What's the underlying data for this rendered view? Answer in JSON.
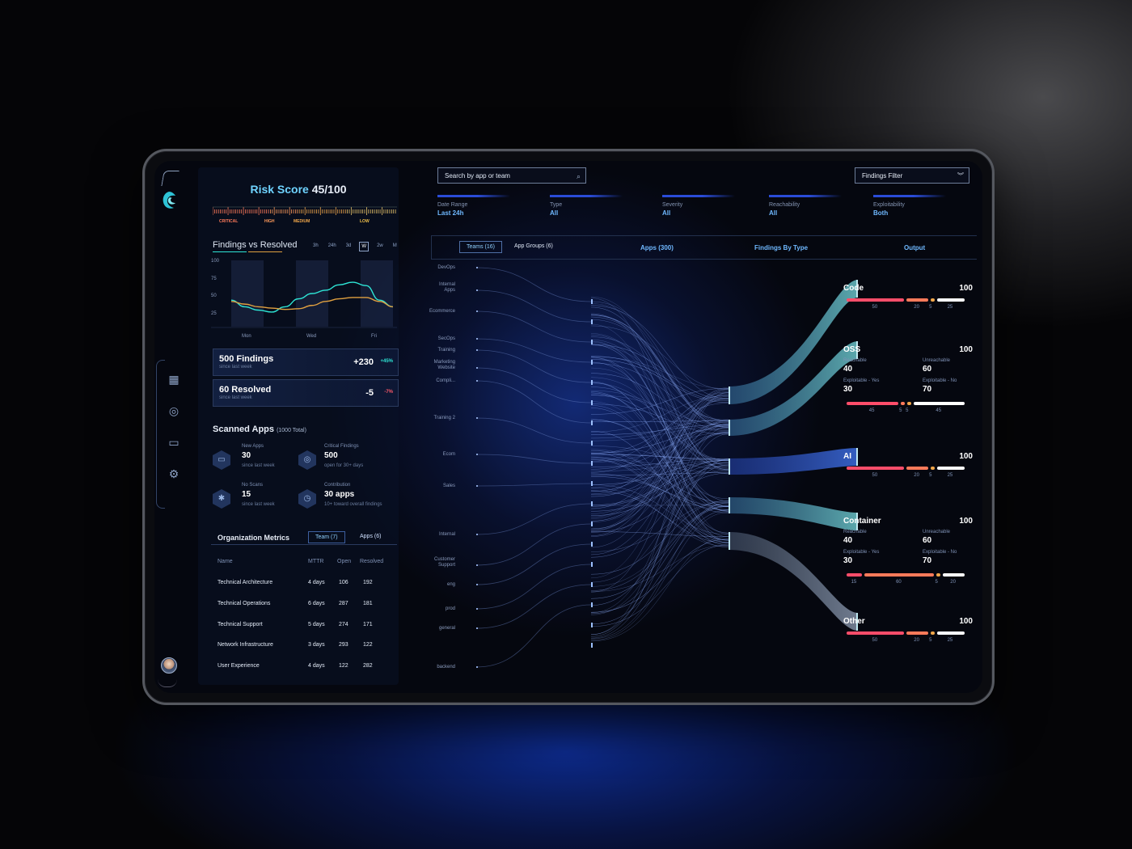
{
  "risk": {
    "label": "Risk Score",
    "value": "45/100",
    "levels": [
      "CRITICAL",
      "HIGH",
      "MEDIUM",
      "LOW"
    ]
  },
  "findings_chart": {
    "title": "Findings vs Resolved",
    "ranges": [
      "3h",
      "24h",
      "3d",
      "W",
      "2w",
      "M"
    ],
    "selected_range": "W",
    "y_ticks": [
      "100",
      "75",
      "50",
      "25"
    ],
    "x_ticks": [
      "Mon",
      "Wed",
      "Fri"
    ]
  },
  "chart_data": {
    "type": "line",
    "ylim": [
      0,
      100
    ],
    "xlabel": "",
    "ylabel": "",
    "x_tick_labels": [
      "Mon",
      "Wed",
      "Fri"
    ],
    "series": [
      {
        "color": "#2ee6d6",
        "values": [
          40,
          30,
          25,
          22,
          30,
          42,
          50,
          55,
          63,
          67,
          62,
          40,
          30
        ]
      },
      {
        "color": "#e0a040",
        "values": [
          38,
          34,
          30,
          28,
          26,
          27,
          32,
          38,
          42,
          44,
          44,
          38,
          30
        ]
      }
    ]
  },
  "stats": [
    {
      "value": "500 Findings",
      "sub": "since last week",
      "delta": "+230",
      "pct": "+45%",
      "pct_color": "#2ee6d6"
    },
    {
      "value": "60 Resolved",
      "sub": "since last week",
      "delta": "-5",
      "pct": "-7%",
      "pct_color": "#ff5a6a"
    }
  ],
  "scanned": {
    "title": "Scanned Apps",
    "total": "(1000 Total)",
    "items": [
      {
        "label": "New Apps",
        "value": "30",
        "sub": "since last week",
        "icon": "window-icon"
      },
      {
        "label": "Critical Findings",
        "value": "500",
        "sub": "open for 30+ days",
        "icon": "target-icon"
      },
      {
        "label": "No Scans",
        "value": "15",
        "sub": "since last week",
        "icon": "puzzle-icon"
      },
      {
        "label": "Contribution",
        "value": "30 apps",
        "sub": "10+ toward overall findings",
        "icon": "clock-icon"
      }
    ]
  },
  "org": {
    "title": "Organization Metrics",
    "tabs": [
      "Team (7)",
      "Apps (6)"
    ],
    "columns": [
      "Name",
      "MTTR",
      "Open",
      "Resolved"
    ],
    "rows": [
      [
        "Technical Architecture",
        "4 days",
        "106",
        "192"
      ],
      [
        "Technical Operations",
        "6 days",
        "287",
        "181"
      ],
      [
        "Technical Support",
        "5 days",
        "274",
        "171"
      ],
      [
        "Network Infrastructure",
        "3 days",
        "293",
        "122"
      ],
      [
        "User Experience",
        "4 days",
        "122",
        "282"
      ]
    ]
  },
  "search": {
    "placeholder": "Search by app or team"
  },
  "findings_filter": "Findings Filter",
  "filters": [
    {
      "label": "Date Range",
      "value": "Last 24h"
    },
    {
      "label": "Type",
      "value": "All"
    },
    {
      "label": "Severity",
      "value": "All"
    },
    {
      "label": "Reachability",
      "value": "All"
    },
    {
      "label": "Exploitability",
      "value": "Both"
    }
  ],
  "flow_tabs": {
    "teams": "Teams (16)",
    "groups": "App Groups (6)",
    "apps": "Apps (300)",
    "types": "Findings By Type",
    "output": "Output"
  },
  "sources": [
    "DevOps",
    "Internal\nApps",
    "Ecommerce",
    "SecOps",
    "Training",
    "Marketing\nWebsite",
    "Compli...",
    "Training 2",
    "Ecom",
    "Sales",
    "Internal",
    "Customer\nSupport",
    "eng",
    "prod",
    "general",
    "backend"
  ],
  "outputs": [
    {
      "name": "Code",
      "score": "100",
      "bars": [
        "50",
        "20",
        "5",
        "25"
      ]
    },
    {
      "name": "OSS",
      "score": "100",
      "reachable": "40",
      "unreachable": "60",
      "expl_yes": "30",
      "expl_no": "70",
      "bars": [
        "45",
        "5",
        "5",
        "45"
      ]
    },
    {
      "name": "AI",
      "score": "100",
      "bars": [
        "50",
        "20",
        "5",
        "25"
      ]
    },
    {
      "name": "Container",
      "score": "100",
      "reachable": "40",
      "unreachable": "60",
      "expl_yes": "30",
      "expl_no": "70",
      "bars": [
        "15",
        "60",
        "5",
        "20"
      ]
    },
    {
      "name": "Other",
      "score": "100",
      "bars": [
        "50",
        "20",
        "5",
        "25"
      ]
    }
  ],
  "out_labels": {
    "reachable": "Reachable",
    "unreachable": "Unreachable",
    "expl_yes": "Exploitable - Yes",
    "expl_no": "Exploitable - No"
  },
  "colors": {
    "critical": "#ff4d6a",
    "high": "#ff7a5a",
    "medium": "#f0a64a",
    "low": "#ffffff",
    "accent": "#6fb8ff",
    "teal": "#2ee6d6"
  }
}
